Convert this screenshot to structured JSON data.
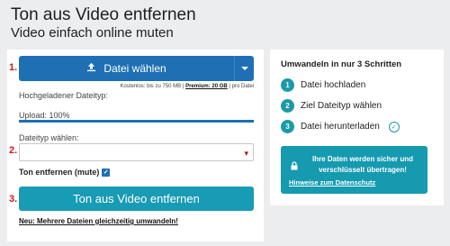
{
  "header": {
    "title": "Ton aus Video entfernen",
    "subtitle": "Video einfach online muten"
  },
  "steps": {
    "one": "1.",
    "two": "2.",
    "three": "3."
  },
  "upload": {
    "button_label": "Datei wählen",
    "limit_prefix": "Kostenlos: bis zu 750 MB |",
    "limit_premium": "Premium: 20 GB",
    "limit_suffix": "| pro Datei"
  },
  "uploaded_type_label": "Hochgeladener Dateityp:",
  "upload_status": "Upload: 100%",
  "upload_progress": 1.0,
  "filetype": {
    "label": "Dateityp wählen:",
    "value": ""
  },
  "mute": {
    "label": "Ton entfernen (mute)",
    "checked": true
  },
  "action_button": "Ton aus Video entfernen",
  "multi_link": "Neu: Mehrere Dateien gleichzeitig umwandeln!",
  "howto": {
    "title": "Umwandeln in nur 3 Schritten",
    "steps": [
      {
        "num": "1",
        "label": "Datei hochladen"
      },
      {
        "num": "2",
        "label": "Ziel Dateityp wählen"
      },
      {
        "num": "3",
        "label": "Datei herunterladen"
      }
    ]
  },
  "security": {
    "text": "Ihre Daten werden sicher und verschlüsselt übertragen!",
    "link": "Hinweise zum Datenschutz"
  },
  "colors": {
    "primary": "#1f6fb5",
    "teal": "#159ab0",
    "step_red": "#d01818"
  }
}
